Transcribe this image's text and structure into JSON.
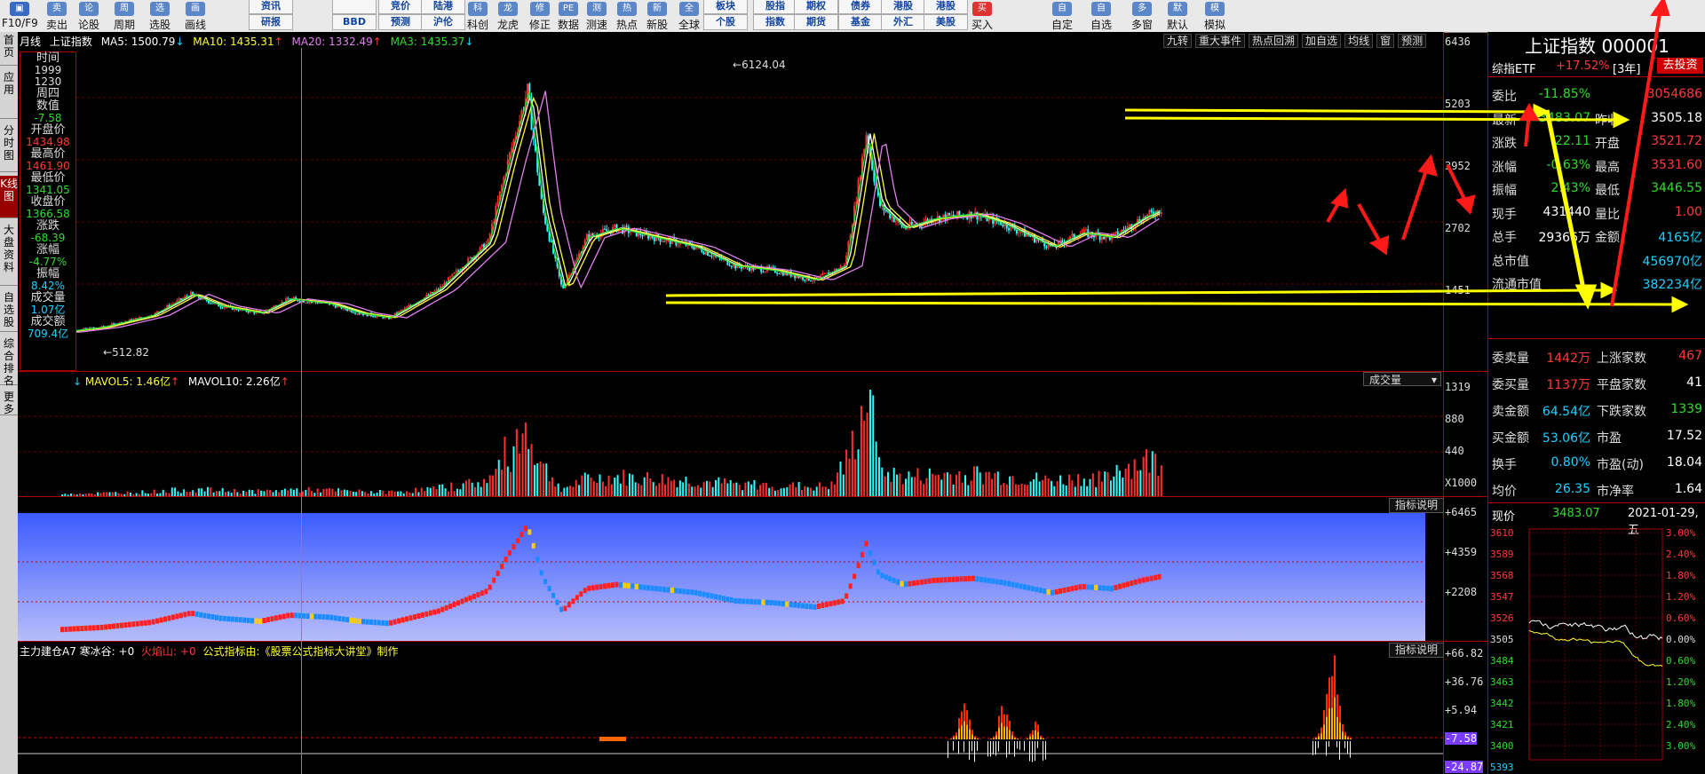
{
  "toolbar": {
    "items": [
      {
        "label": "卖出",
        "icon": "卖"
      },
      {
        "label": "论股",
        "icon": "论"
      },
      {
        "label": "周期",
        "icon": "周"
      },
      {
        "label": "选股",
        "icon": "选"
      },
      {
        "label": "画线",
        "icon": "画"
      },
      {
        "label": "科创",
        "icon": "科"
      },
      {
        "label": "龙虎",
        "icon": "龙"
      },
      {
        "label": "修正",
        "icon": "修"
      },
      {
        "label": "数据",
        "icon": "PE"
      },
      {
        "label": "测速",
        "icon": "测"
      },
      {
        "label": "热点",
        "icon": "热"
      },
      {
        "label": "新股",
        "icon": "新"
      },
      {
        "label": "全球",
        "icon": "全"
      },
      {
        "label": "买入",
        "icon": "买"
      },
      {
        "label": "自定",
        "icon": "自"
      },
      {
        "label": "自选",
        "icon": "自"
      },
      {
        "label": "多窗",
        "icon": "多"
      },
      {
        "label": "默认",
        "icon": "默"
      },
      {
        "label": "模拟",
        "icon": "模"
      }
    ],
    "f10_label": "F10/F9",
    "grid_top": [
      "研报",
      "BBD",
      "预测",
      "沪伦",
      "个股",
      "指数",
      "期货",
      "基金",
      "外汇",
      "美股"
    ],
    "grid_top_row": [
      "资讯",
      "",
      "竞价",
      "陆港",
      "板块",
      "股指",
      "期权",
      "债券",
      "港股",
      "港股"
    ]
  },
  "leftnav": [
    "首页",
    "应用",
    "分时图",
    "K线图",
    "大盘资料",
    "自选股",
    "综合排名",
    "更多"
  ],
  "main_header": {
    "period": "月线",
    "name": "上证指数",
    "ma5": "MA5: 1500.79",
    "ma10": "MA10: 1435.31",
    "ma20": "MA20: 1332.49",
    "ma3": "MA3: 1435.37",
    "buttons": [
      "九转",
      "重大事件",
      "热点回溯",
      "加自选",
      "均线",
      "窗",
      "预测"
    ]
  },
  "main_axis": [
    "6436",
    "5203",
    "3952",
    "2702",
    "1451"
  ],
  "annotations": {
    "high": "6124.04",
    "low": "512.82"
  },
  "info_box": [
    {
      "k": "时间",
      "v": "1999"
    },
    {
      "k": "",
      "v": "1230"
    },
    {
      "k": "周四",
      "v": ""
    },
    {
      "k": "数值",
      "v": "-7.58"
    },
    {
      "k": "开盘价",
      "v": "1434.98"
    },
    {
      "k": "最高价",
      "v": "1461.90"
    },
    {
      "k": "最低价",
      "v": "1341.05"
    },
    {
      "k": "收盘价",
      "v": "1366.58"
    },
    {
      "k": "涨跌",
      "v": "-68.39"
    },
    {
      "k": "涨幅",
      "v": "-4.77%"
    },
    {
      "k": "振幅",
      "v": "8.42%"
    },
    {
      "k": "成交量",
      "v": "1.07亿"
    },
    {
      "k": "成交额",
      "v": "709.4亿"
    }
  ],
  "vol_header": {
    "mavol5": "MAVOL5: 1.46亿",
    "mavol10": "MAVOL10: 2.26亿",
    "selector": "成交量"
  },
  "vol_axis": [
    "1319",
    "880",
    "440",
    "X1000"
  ],
  "ind1": {
    "button": "指标说明",
    "axis": [
      "+6465",
      "+4359",
      "+2208"
    ]
  },
  "ind2": {
    "title": "主力建仓A7 寒冰谷: +0",
    "fire": "火焰山: +0",
    "credit": "公式指标由:《股票公式指标大讲堂》制作",
    "button": "指标说明",
    "axis": [
      "+66.82",
      "+36.76",
      "+5.94",
      "-7.58",
      "-24.87"
    ]
  },
  "right": {
    "title": "上证指数 000001",
    "etf": {
      "name": "综指ETF",
      "chg": "+17.52%",
      "term": "[3年]",
      "btn": "去投资"
    },
    "rows": [
      {
        "l": "委比",
        "v": "-11.85%",
        "l2": "",
        "v2": "3054686"
      },
      {
        "l": "最新",
        "v": "3483.07",
        "l2": "昨收",
        "v2": "3505.18"
      },
      {
        "l": "涨跌",
        "v": "-22.11",
        "l2": "开盘",
        "v2": "3521.72"
      },
      {
        "l": "涨幅",
        "v": "-0.63%",
        "l2": "最高",
        "v2": "3531.60"
      },
      {
        "l": "振幅",
        "v": "2.43%",
        "l2": "最低",
        "v2": "3446.55"
      },
      {
        "l": "现手",
        "v": "431440",
        "l2": "量比",
        "v2": "1.00"
      },
      {
        "l": "总手",
        "v": "29366万",
        "l2": "金额",
        "v2": "4165亿"
      },
      {
        "l": "总市值",
        "v": "",
        "l2": "",
        "v2": "456970亿"
      },
      {
        "l": "流通市值",
        "v": "",
        "l2": "",
        "v2": "382234亿"
      }
    ],
    "rows2": [
      {
        "l": "委卖量",
        "v": "1442万",
        "l2": "上涨家数",
        "v2": "467"
      },
      {
        "l": "委买量",
        "v": "1137万",
        "l2": "平盘家数",
        "v2": "41"
      },
      {
        "l": "卖金额",
        "v": "64.54亿",
        "l2": "下跌家数",
        "v2": "1339"
      },
      {
        "l": "买金额",
        "v": "53.06亿",
        "l2": "市盈",
        "v2": "17.52"
      },
      {
        "l": "换手",
        "v": "0.80%",
        "l2": "市盈(动)",
        "v2": "18.04"
      },
      {
        "l": "均价",
        "v": "26.35",
        "l2": "市净率",
        "v2": "1.64"
      }
    ],
    "mini": {
      "label": "现价",
      "price": "3483.07",
      "date": "2021-01-29,五",
      "left_axis": [
        "3610",
        "3589",
        "3568",
        "3547",
        "3526",
        "3505",
        "3484",
        "3463",
        "3442",
        "3421",
        "3400",
        "5393"
      ],
      "right_axis": [
        "3.00%",
        "2.40%",
        "1.80%",
        "1.20%",
        "0.60%",
        "0.00%",
        "0.60%",
        "1.20%",
        "1.80%",
        "2.40%",
        "3.00%"
      ]
    }
  }
}
